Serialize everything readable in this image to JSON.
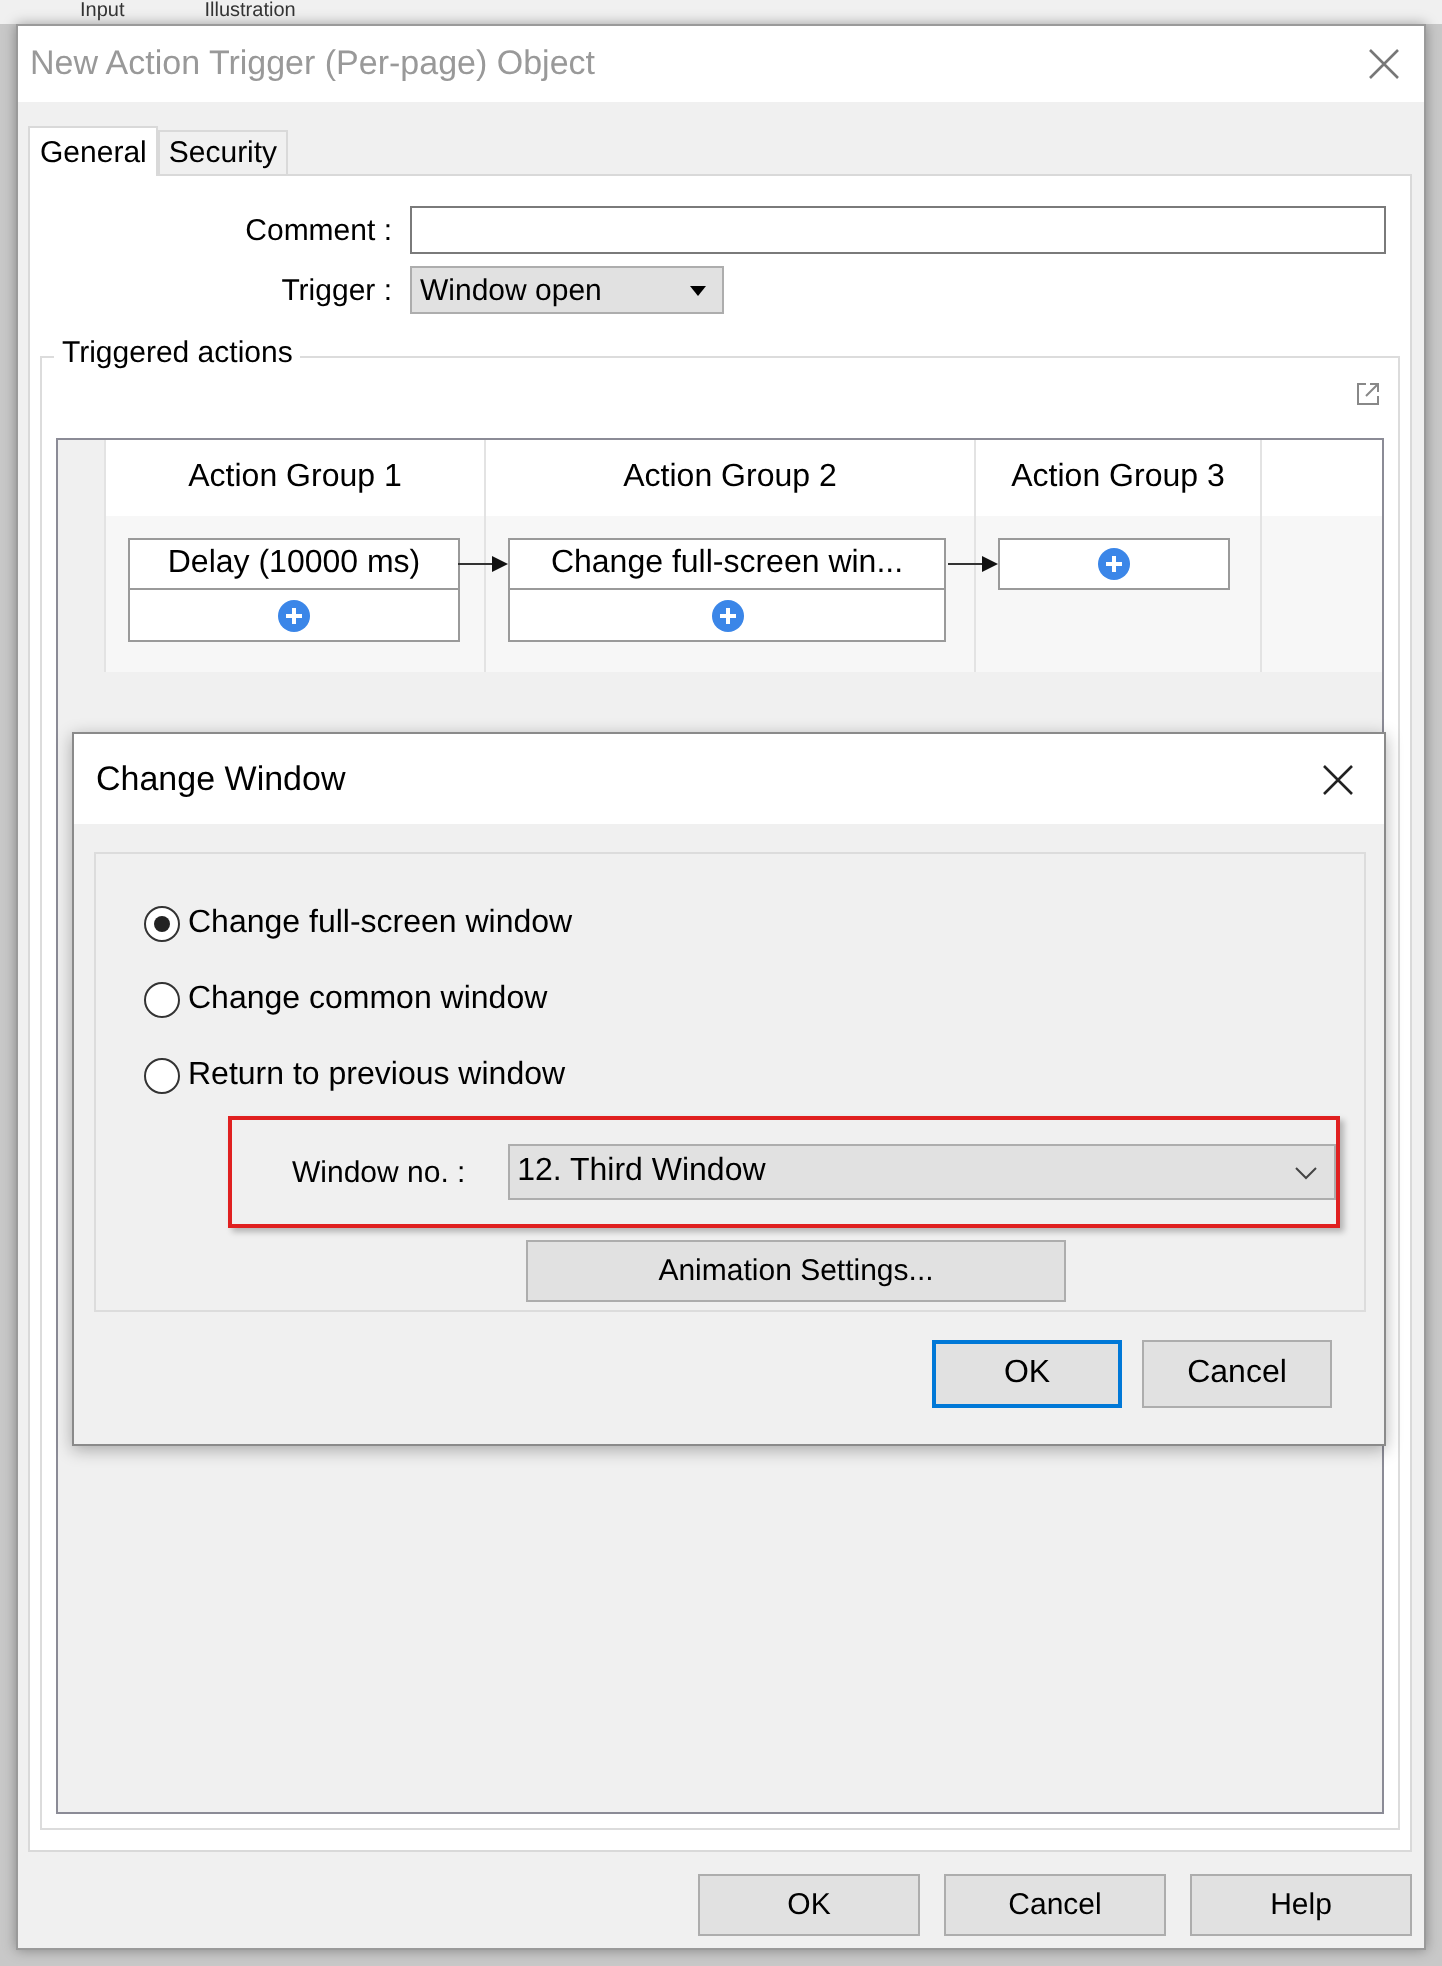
{
  "background_tabs": [
    "Input",
    "Illustration"
  ],
  "window": {
    "title": "New Action Trigger (Per-page) Object"
  },
  "tabs": [
    {
      "label": "General",
      "selected": true
    },
    {
      "label": "Security",
      "selected": false
    }
  ],
  "form": {
    "comment": {
      "label": "Comment :"
    },
    "trigger": {
      "label": "Trigger :",
      "value": "Window open"
    }
  },
  "triggered_actions": {
    "title": "Triggered actions",
    "groups": [
      {
        "header": "Action Group 1",
        "actions": [
          "Delay (10000 ms)"
        ]
      },
      {
        "header": "Action Group 2",
        "actions": [
          "Change full-screen win..."
        ]
      },
      {
        "header": "Action Group 3"
      }
    ]
  },
  "change_window_dialog": {
    "title": "Change Window",
    "options": [
      {
        "label": "Change full-screen window",
        "selected": true
      },
      {
        "label": "Change common window",
        "selected": false
      },
      {
        "label": "Return to previous window",
        "selected": false
      }
    ],
    "window_no": {
      "label": "Window no. :",
      "value": "12. Third Window",
      "highlighted": true
    },
    "animation_button": "Animation Settings...",
    "buttons": [
      {
        "label": "OK",
        "default": true
      },
      {
        "label": "Cancel",
        "default": false
      }
    ]
  },
  "buttons": [
    "OK",
    "Cancel",
    "Help"
  ]
}
